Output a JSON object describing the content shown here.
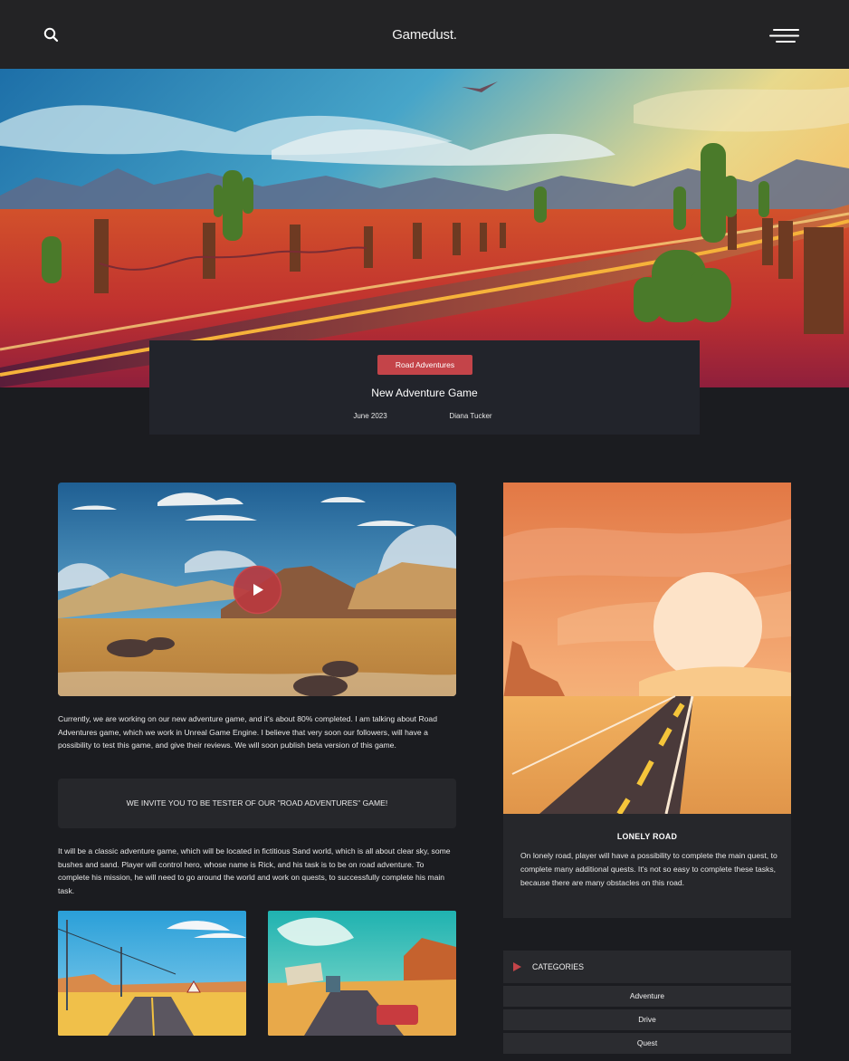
{
  "header": {
    "brand": "Gamedust.",
    "search_icon": "search-icon",
    "menu_icon": "menu-icon"
  },
  "post": {
    "category": "Road Adventures",
    "title": "New Adventure Game",
    "date": "June 2023",
    "author": "Diana Tucker"
  },
  "article": {
    "intro": "Currently, we are working on our new adventure game, and it's about 80% completed. I am talking about Road Adventures game, which we work in Unreal Game Engine. I believe that very soon our followers, will have a possibility to test this game, and give their reviews. We will soon publish beta version of this game.",
    "invite": "WE INVITE YOU TO BE TESTER OF OUR \"ROAD ADVENTURES\" GAME!",
    "details": "It will be a classic adventure game, which will be located in fictitious Sand world, which is all about clear sky, some bushes and sand. Player will control hero, whose name is Rick, and his task is to be on road adventure. To complete his mission, he will need to go around the world and work on quests, to successfully complete his main task.",
    "play_icon": "play-icon"
  },
  "sidebar": {
    "feature_title": "LONELY ROAD",
    "feature_text": "On lonely road, player will have a possibility to complete the main quest, to complete many additional quests. It's not so easy to complete these tasks, because there are many obstacles on this road.",
    "categories_title": "CATEGORIES",
    "categories": [
      "Adventure",
      "Drive",
      "Quest"
    ]
  },
  "colors": {
    "accent": "#c44449",
    "background": "#1b1c20",
    "header": "#232325",
    "card": "#26272b"
  }
}
